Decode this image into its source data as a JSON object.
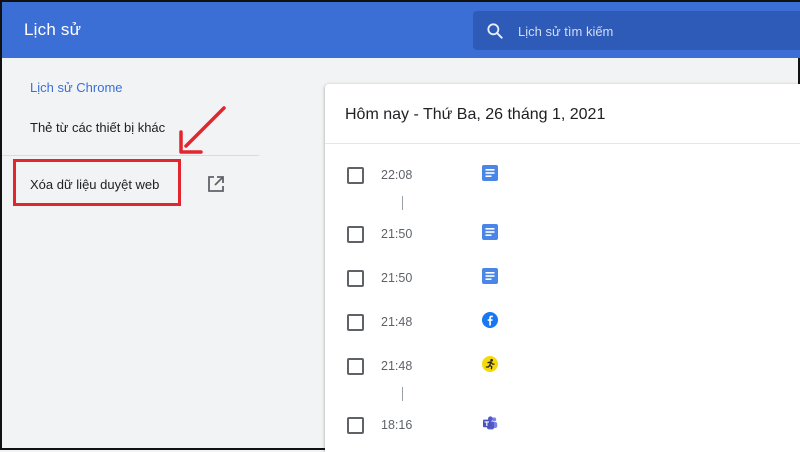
{
  "header": {
    "title": "Lịch sử",
    "search_placeholder": "Lịch sử tìm kiếm",
    "color": "#3c6fd6"
  },
  "sidebar": {
    "items": [
      {
        "label": "Lịch sử Chrome",
        "active": true
      },
      {
        "label": "Thẻ từ các thiết bị khác",
        "active": false
      }
    ],
    "clear_data_label": "Xóa dữ liệu duyệt web",
    "clear_data_icon": "open-in-new-icon",
    "highlight_color": "#e3262e"
  },
  "main": {
    "day_title": "Hôm nay - Thứ Ba, 26 tháng 1, 2021",
    "entries": [
      {
        "time": "22:08",
        "icon": "docs-icon"
      },
      {
        "time": "21:50",
        "icon": "docs-icon"
      },
      {
        "time": "21:50",
        "icon": "docs-icon"
      },
      {
        "time": "21:48",
        "icon": "facebook-icon"
      },
      {
        "time": "21:48",
        "icon": "running-man-icon"
      },
      {
        "time": "18:16",
        "icon": "teams-icon"
      }
    ]
  }
}
